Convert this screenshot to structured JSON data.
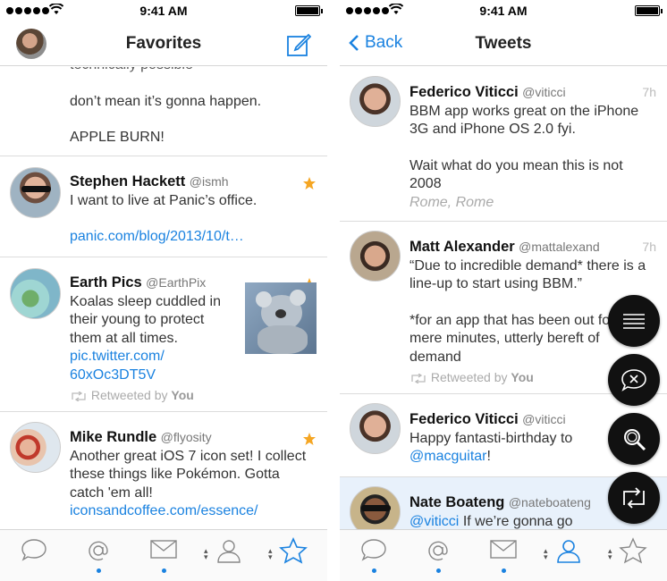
{
  "status": {
    "time": "9:41 AM"
  },
  "left": {
    "title": "Favorites",
    "partial": {
      "line1": "technically possible",
      "line2": "don’t mean it’s gonna happen.",
      "line3": "APPLE BURN!"
    },
    "tweets": [
      {
        "name": "Stephen Hackett",
        "handle": "@ismh",
        "text": "I want to live at Panic’s office.",
        "link": "panic.com/blog/2013/10/t…"
      },
      {
        "name": "Earth Pics",
        "handle": "@EarthPix",
        "text": "Koalas sleep cuddled in their young to protect them at all times.",
        "link1": "pic.twitter.com/",
        "link2": "60xOc3DT5V",
        "retweet_label": "Retweeted by",
        "retweet_by": "You"
      },
      {
        "name": "Mike Rundle",
        "handle": "@flyosity",
        "text": "Another great iOS 7 icon set! I collect these things like Pokémon. Gotta catch 'em all!",
        "link": "iconsandcoffee.com/essence/"
      }
    ]
  },
  "right": {
    "back_label": "Back",
    "title": "Tweets",
    "tweets": [
      {
        "name": "Federico Viticci",
        "handle": "@viticci",
        "age": "7h",
        "text": "BBM app works great on the iPhone 3G and iPhone OS 2.0 fyi.",
        "text2": "Wait what do you mean this is not 2008",
        "place": "Rome, Rome"
      },
      {
        "name": "Matt Alexander",
        "handle": "@mattalexand",
        "age": "7h",
        "text": "“Due to incredible demand* there is a line-up to start using BBM.”",
        "text2": "*for an app that has been out for mere minutes, utterly bereft of demand",
        "retweet_label": "Retweeted by",
        "retweet_by": "You"
      },
      {
        "name": "Federico Viticci",
        "handle": "@viticci",
        "text": "Happy fantasti-birthday to",
        "mention": "@macguitar",
        "text_end": "!"
      },
      {
        "name": "Nate Boateng",
        "handle": "@nateboateng",
        "mention": "@viticci",
        "text": "If we’re gonna go old"
      }
    ]
  },
  "colors": {
    "accent": "#1a82e0",
    "star": "#f5a623",
    "highlight": "#e8f1fb"
  },
  "icons": {
    "tabs": [
      "speech-bubble-icon",
      "at-icon",
      "envelope-icon",
      "person-icon",
      "star-icon"
    ],
    "fabs": [
      "list-icon",
      "speech-bubble-x-icon",
      "search-icon",
      "retweet-icon"
    ]
  }
}
